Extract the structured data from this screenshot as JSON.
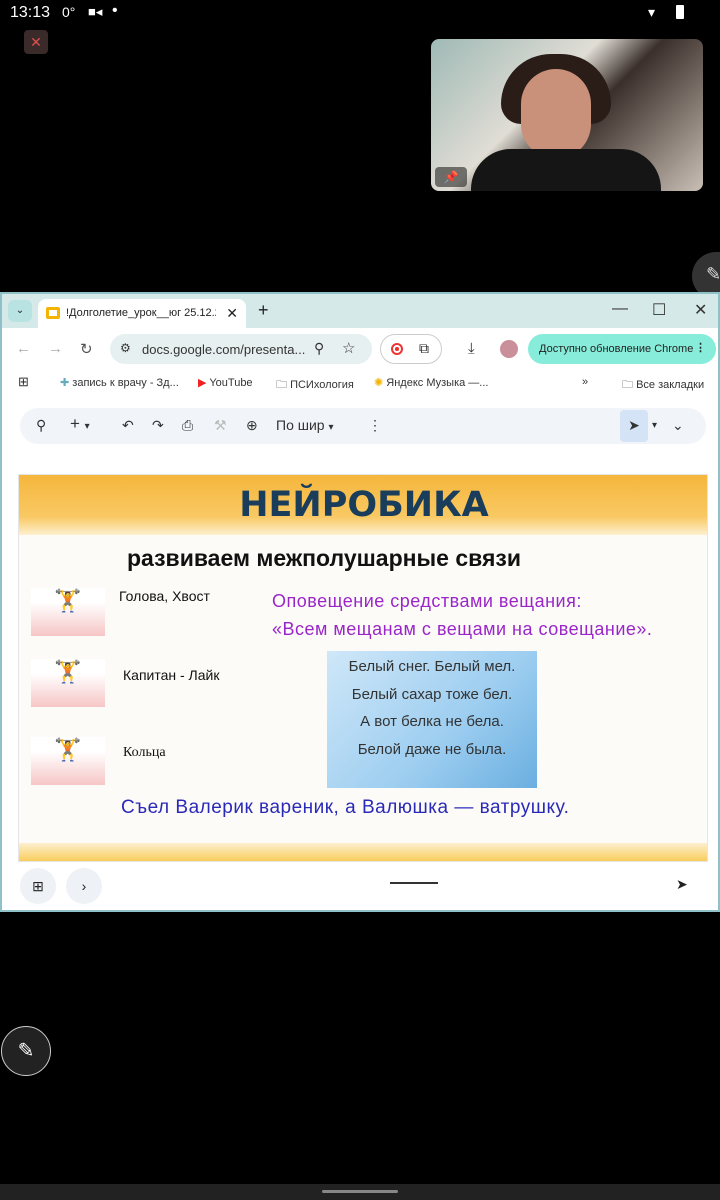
{
  "status": {
    "time": "13:13",
    "temp": "0°"
  },
  "browser": {
    "tab_title": "!Долголетие_урок__юг 25.12.24",
    "url": "docs.google.com/presenta...",
    "update_label": "Доступно обновление Chrome",
    "bookmarks": [
      "запись к врачу - Зд...",
      "YouTube",
      "ПСИхология",
      "Яндекс Музыка —..."
    ],
    "all_bookmarks": "Все закладки",
    "more": "»"
  },
  "toolbar": {
    "zoom_label": "По шир"
  },
  "slide": {
    "title": "НЕЙРОБИКА",
    "subtitle": "развиваем межполушарные связи",
    "exercises": [
      "Голова, Хвост",
      "Капитан - Лайк",
      "Кольца"
    ],
    "tongue_twister_1": [
      "Оповещение средствами вещания:",
      "«Всем мещанам с вещами на совещание»."
    ],
    "poem": [
      "Белый снег. Белый мел.",
      "Белый сахар тоже бел.",
      "А вот белка не бела.",
      "Белой даже не была."
    ],
    "tongue_twister_2": "Съел Валерик вареник, а Валюшка — ватрушку."
  }
}
